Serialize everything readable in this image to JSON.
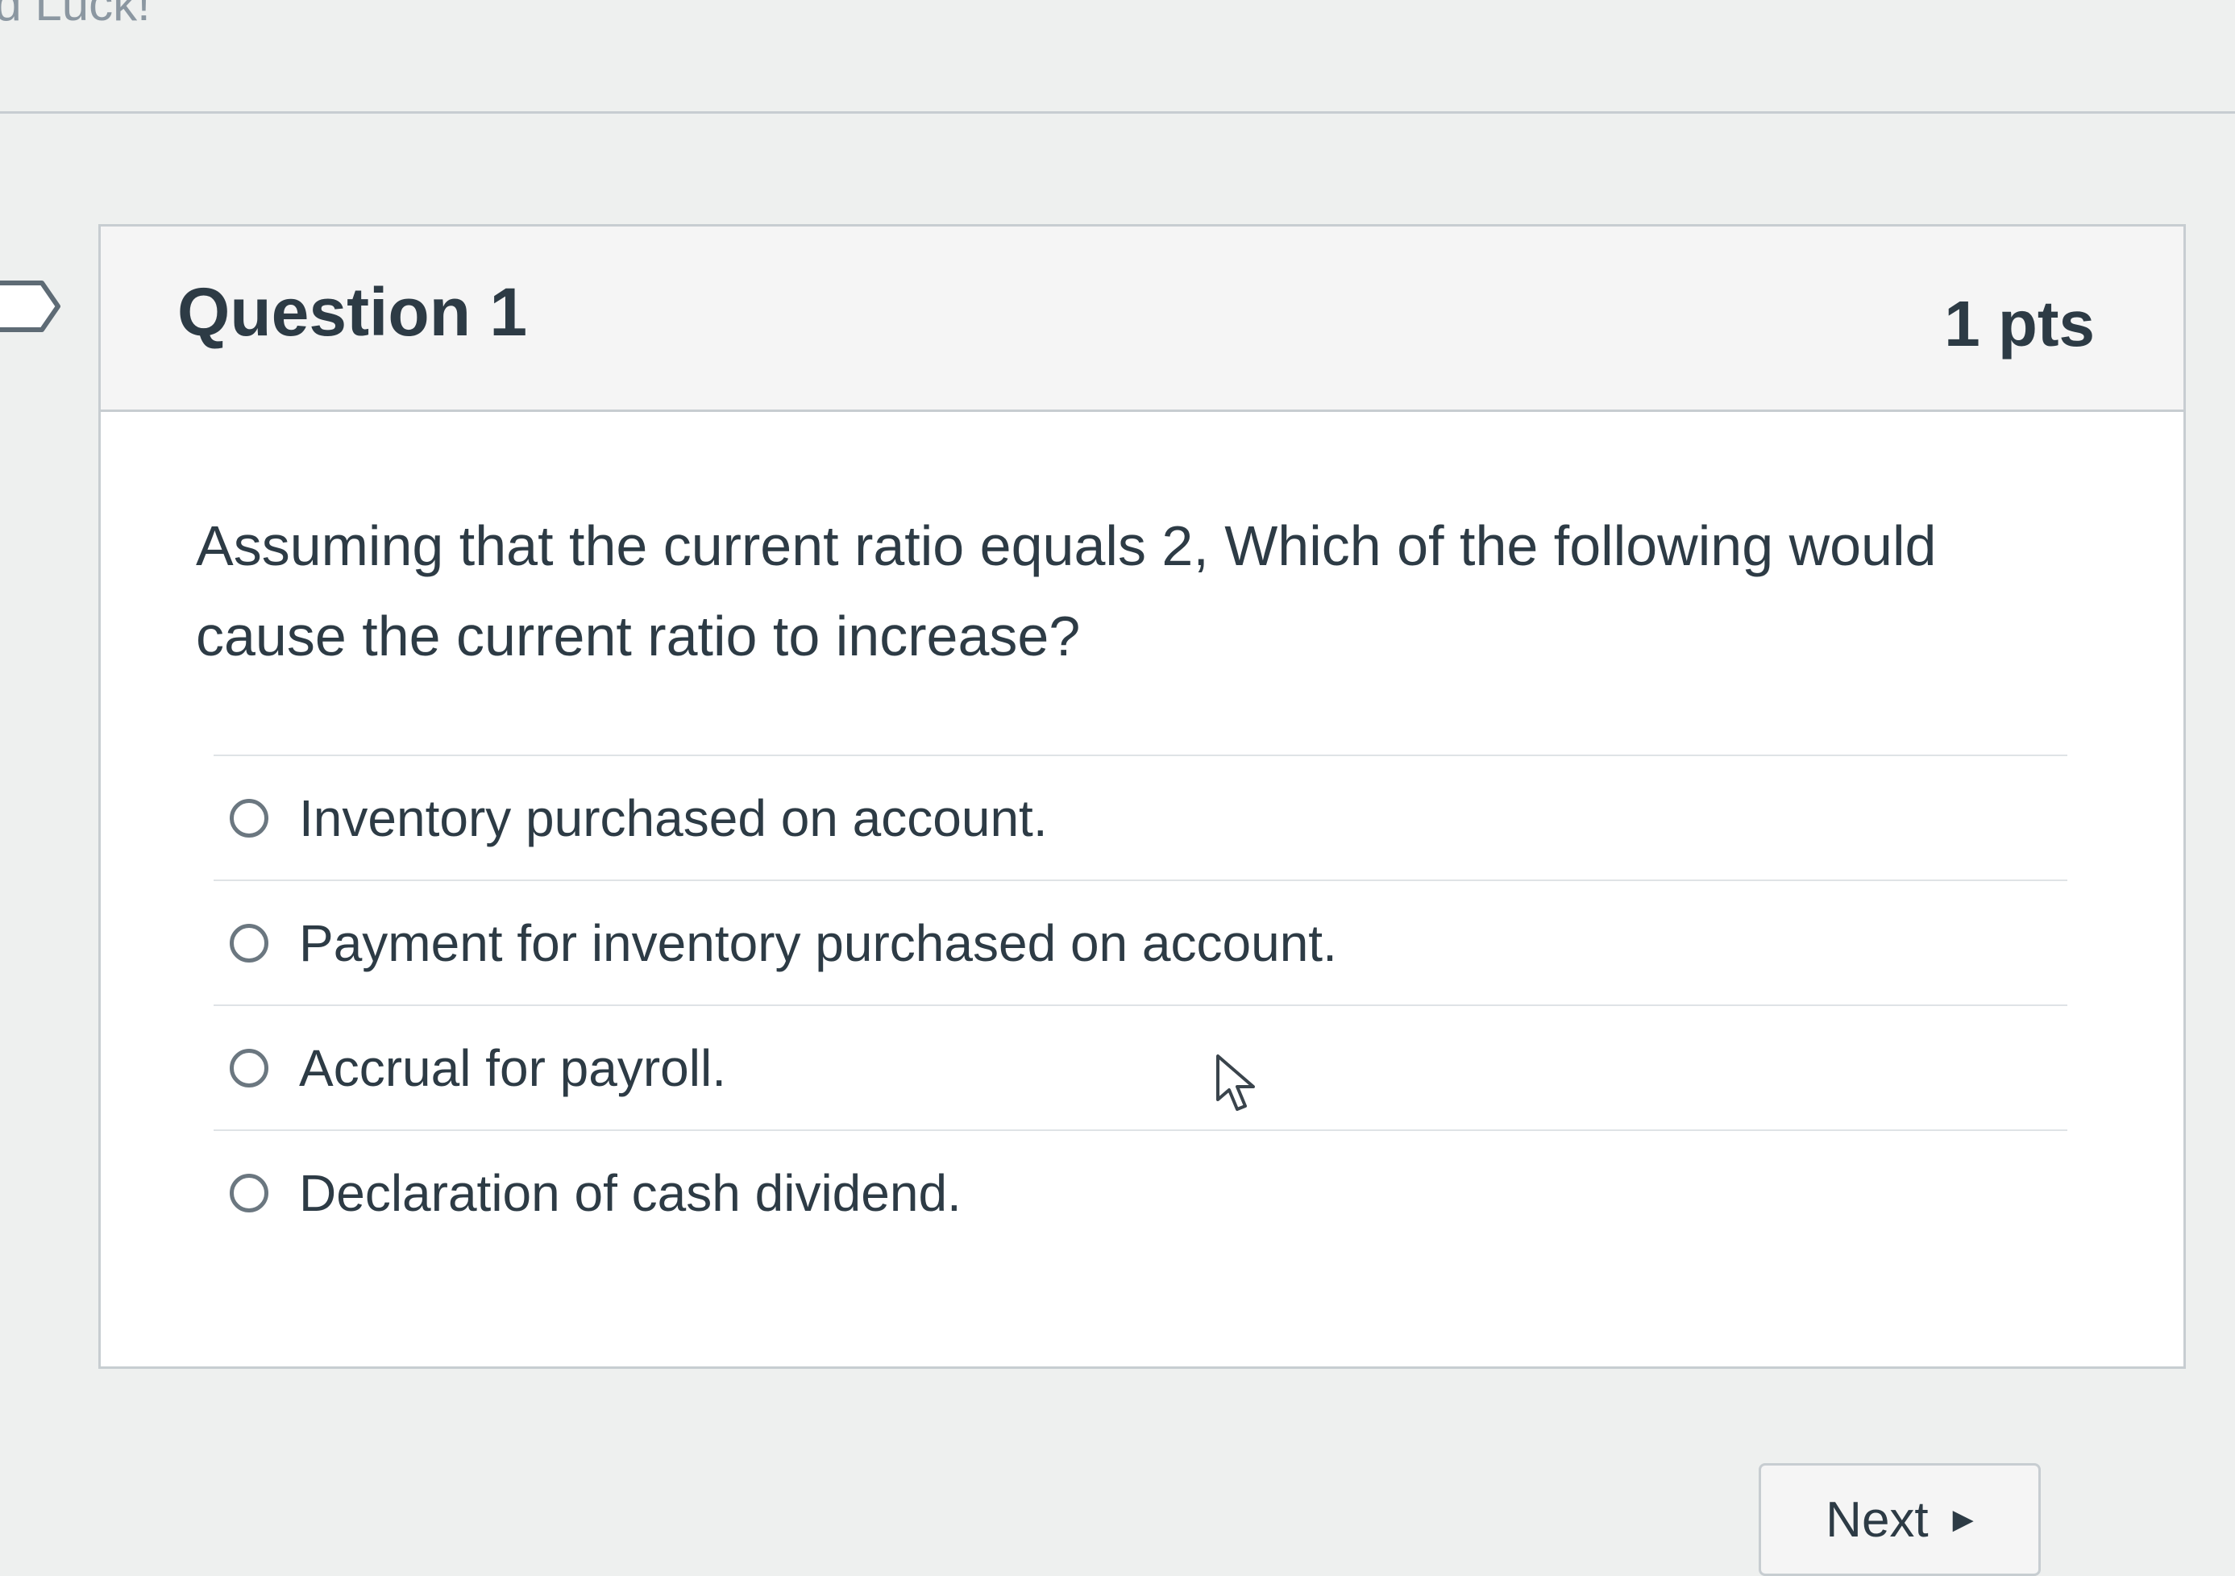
{
  "banner": {
    "text": "od Luck!"
  },
  "question": {
    "title": "Question 1",
    "points": "1 pts",
    "text": "Assuming that the current ratio equals 2, Which of the following would cause the current ratio to increase?",
    "answers": [
      {
        "label": "Inventory purchased on account."
      },
      {
        "label": "Payment for inventory purchased on account."
      },
      {
        "label": "Accrual for payroll."
      },
      {
        "label": "Declaration of cash dividend."
      }
    ]
  },
  "navigation": {
    "next_label": "Next",
    "next_icon": "triangle-right-icon"
  },
  "icons": {
    "flag": "flag-icon",
    "cursor": "mouse-pointer-icon"
  }
}
